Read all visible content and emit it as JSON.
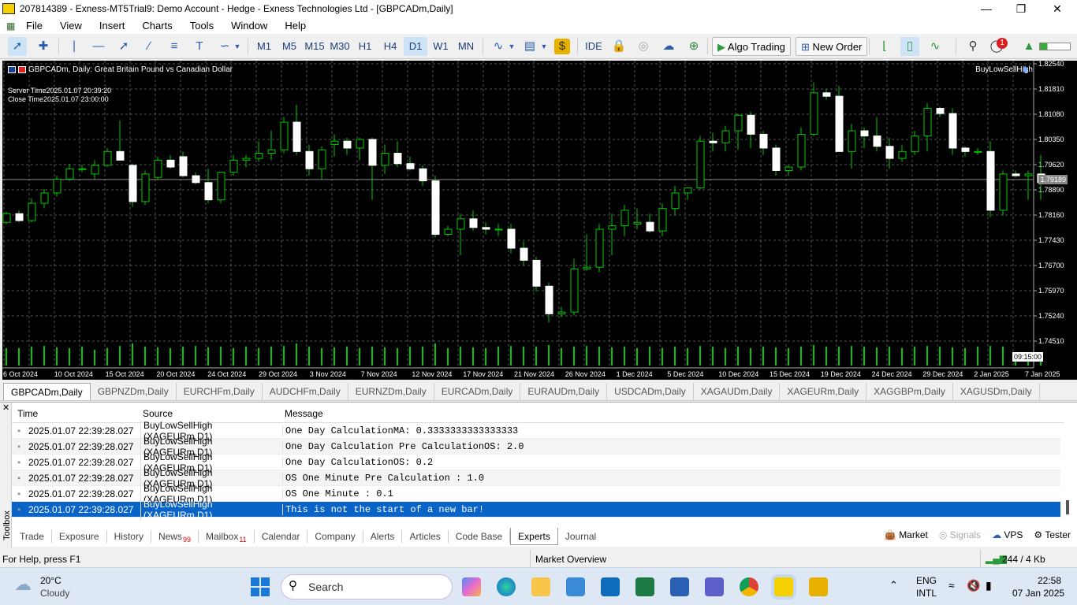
{
  "window": {
    "title": "207814389 - Exness-MT5Trial9: Demo Account - Hedge - Exness Technologies Ltd - [GBPCADm,Daily]"
  },
  "menu": [
    "File",
    "View",
    "Insert",
    "Charts",
    "Tools",
    "Window",
    "Help"
  ],
  "toolbar": {
    "timeframes": [
      "M1",
      "M5",
      "M15",
      "M30",
      "H1",
      "H4",
      "D1",
      "W1",
      "MN"
    ],
    "active_timeframe": "D1",
    "ide_label": "IDE",
    "algo_trading_label": "Algo Trading",
    "new_order_label": "New Order",
    "notification_count": "1"
  },
  "chart": {
    "header": "GBPCADm, Daily:  Great Britain Pound vs Canadian Dollar",
    "server_time": "Server Time2025.01.07 20:39:20",
    "close_time": "Close Time2025.01.07 23:00:00",
    "ea_name": "BuyLowSellHigh",
    "current_price": "1.79189",
    "countdown": "09:15:00",
    "price_labels": [
      "1.82540",
      "1.81810",
      "1.81080",
      "1.80350",
      "1.79620",
      "1.78890",
      "1.78160",
      "1.77430",
      "1.76700",
      "1.75970",
      "1.75240",
      "1.74510"
    ],
    "date_labels": [
      "6 Oct 2024",
      "10 Oct 2024",
      "15 Oct 2024",
      "20 Oct 2024",
      "24 Oct 2024",
      "29 Oct 2024",
      "3 Nov 2024",
      "7 Nov 2024",
      "12 Nov 2024",
      "17 Nov 2024",
      "21 Nov 2024",
      "26 Nov 2024",
      "1 Dec 2024",
      "5 Dec 2024",
      "10 Dec 2024",
      "15 Dec 2024",
      "19 Dec 2024",
      "24 Dec 2024",
      "29 Dec 2024",
      "2 Jan 2025",
      "7 Jan 2025"
    ]
  },
  "chart_tabs": [
    "GBPCADm,Daily",
    "GBPNZDm,Daily",
    "EURCHFm,Daily",
    "AUDCHFm,Daily",
    "EURNZDm,Daily",
    "EURCADm,Daily",
    "EURAUDm,Daily",
    "USDCADm,Daily",
    "XAGAUDm,Daily",
    "XAGEURm,Daily",
    "XAGGBPm,Daily",
    "XAGUSDm,Daily"
  ],
  "log": {
    "headers": {
      "time": "Time",
      "source": "Source",
      "message": "Message"
    },
    "rows": [
      {
        "time": "2025.01.07 22:39:28.027",
        "source": "BuyLowSellHigh (XAGEURm,D1)",
        "message": "One Day CalculationMA: 0.3333333333333333"
      },
      {
        "time": "2025.01.07 22:39:28.027",
        "source": "BuyLowSellHigh (XAGEURm,D1)",
        "message": "One Day Calculation Pre CalculationOS: 2.0"
      },
      {
        "time": "2025.01.07 22:39:28.027",
        "source": "BuyLowSellHigh (XAGEURm,D1)",
        "message": "One Day CalculationOS: 0.2"
      },
      {
        "time": "2025.01.07 22:39:28.027",
        "source": "BuyLowSellHigh (XAGEURm,D1)",
        "message": "OS One Minute Pre Calculation : 1.0"
      },
      {
        "time": "2025.01.07 22:39:28.027",
        "source": "BuyLowSellHigh (XAGEURm,D1)",
        "message": "OS One Minute : 0.1"
      },
      {
        "time": "2025.01.07 22:39:28.027",
        "source": "BuyLowSellHigh (XAGEURm,D1)",
        "message": "This is not the start of a new bar!"
      }
    ]
  },
  "toolbox": {
    "label": "Toolbox",
    "tabs": [
      "Trade",
      "Exposure",
      "History",
      "News",
      "Mailbox",
      "Calendar",
      "Company",
      "Alerts",
      "Articles",
      "Code Base",
      "Experts",
      "Journal"
    ],
    "news_count": "99",
    "mailbox_count": "11",
    "active_tab": "Experts",
    "right": [
      "Market",
      "Signals",
      "VPS",
      "Tester"
    ]
  },
  "status": {
    "help": "For Help, press F1",
    "market": "Market Overview",
    "traffic": "244 / 4 Kb"
  },
  "taskbar": {
    "temp": "20°C",
    "weather": "Cloudy",
    "search": "Search",
    "lang": "ENG",
    "layout": "INTL",
    "time": "22:58",
    "date": "07 Jan 2025"
  },
  "colors": {
    "accent": "#0a64c8",
    "chart_bg": "#000000",
    "bull": "#00c800",
    "bear": "#ffffff",
    "selected_row": "#0a64c8"
  },
  "candles": [
    [
      1.7795,
      1.7825,
      1.779,
      1.782
    ],
    [
      1.782,
      1.783,
      1.7795,
      1.78
    ],
    [
      1.78,
      1.7865,
      1.7795,
      1.785
    ],
    [
      1.785,
      1.7892,
      1.7835,
      1.788
    ],
    [
      1.788,
      1.793,
      1.787,
      1.792
    ],
    [
      1.792,
      1.7965,
      1.7915,
      1.795
    ],
    [
      1.795,
      1.7962,
      1.794,
      1.795
    ],
    [
      1.7935,
      1.7975,
      1.792,
      1.796
    ],
    [
      1.796,
      1.801,
      1.7955,
      1.8
    ],
    [
      1.8,
      1.809,
      1.7975,
      1.7975
    ],
    [
      1.796,
      1.7965,
      1.784,
      1.7855
    ],
    [
      1.7855,
      1.7945,
      1.7845,
      1.7935
    ],
    [
      1.7925,
      1.7985,
      1.792,
      1.7975
    ],
    [
      1.7975,
      1.799,
      1.795,
      1.7955
    ],
    [
      1.7985,
      1.8,
      1.7925,
      1.793
    ],
    [
      1.793,
      1.794,
      1.7905,
      1.791
    ],
    [
      1.791,
      1.795,
      1.785,
      1.786
    ],
    [
      1.786,
      1.794,
      1.785,
      1.794
    ],
    [
      1.794,
      1.799,
      1.793,
      1.7975
    ],
    [
      1.7975,
      1.799,
      1.7955,
      1.798
    ],
    [
      1.798,
      1.803,
      1.797,
      1.7995
    ],
    [
      1.7995,
      1.806,
      1.7975,
      1.8005
    ],
    [
      1.8005,
      1.81,
      1.7995,
      1.8085
    ],
    [
      1.8085,
      1.8135,
      1.799,
      1.8
    ],
    [
      1.8,
      1.802,
      1.793,
      1.795
    ],
    [
      1.795,
      1.8015,
      1.792,
      1.8005
    ],
    [
      1.802,
      1.805,
      1.7985,
      1.803
    ],
    [
      1.803,
      1.804,
      1.799,
      1.801
    ],
    [
      1.801,
      1.804,
      1.7975,
      1.8035
    ],
    [
      1.8035,
      1.804,
      1.786,
      1.796
    ],
    [
      1.796,
      1.802,
      1.7935,
      1.7995
    ],
    [
      1.7995,
      1.803,
      1.7955,
      1.7965
    ],
    [
      1.7965,
      1.7985,
      1.7945,
      1.795
    ],
    [
      1.795,
      1.796,
      1.79,
      1.7915
    ],
    [
      1.7915,
      1.793,
      1.775,
      1.776
    ],
    [
      1.776,
      1.7785,
      1.7755,
      1.7775
    ],
    [
      1.7775,
      1.782,
      1.77,
      1.7805
    ],
    [
      1.7805,
      1.783,
      1.777,
      1.778
    ],
    [
      1.778,
      1.7795,
      1.776,
      1.7775
    ],
    [
      1.7775,
      1.779,
      1.7755,
      1.7775
    ],
    [
      1.7775,
      1.779,
      1.7705,
      1.772
    ],
    [
      1.772,
      1.774,
      1.767,
      1.7685
    ],
    [
      1.7685,
      1.7695,
      1.7595,
      1.761
    ],
    [
      1.761,
      1.762,
      1.7505,
      1.753
    ],
    [
      1.753,
      1.755,
      1.752,
      1.7535
    ],
    [
      1.7535,
      1.769,
      1.7525,
      1.766
    ],
    [
      1.766,
      1.776,
      1.7655,
      1.7665
    ],
    [
      1.7665,
      1.779,
      1.765,
      1.7775
    ],
    [
      1.7775,
      1.782,
      1.77,
      1.7785
    ],
    [
      1.7785,
      1.7845,
      1.7755,
      1.783
    ],
    [
      1.779,
      1.7835,
      1.7775,
      1.7795
    ],
    [
      1.7795,
      1.782,
      1.7765,
      1.777
    ],
    [
      1.777,
      1.785,
      1.7755,
      1.7835
    ],
    [
      1.7835,
      1.79,
      1.7815,
      1.788
    ],
    [
      1.788,
      1.7895,
      1.786,
      1.7895
    ],
    [
      1.7895,
      1.8045,
      1.789,
      1.803
    ],
    [
      1.803,
      1.8055,
      1.8,
      1.8025
    ],
    [
      1.8025,
      1.8075,
      1.8,
      1.806
    ],
    [
      1.806,
      1.811,
      1.8005,
      1.8105
    ],
    [
      1.8105,
      1.8115,
      1.801,
      1.805
    ],
    [
      1.805,
      1.806,
      1.799,
      1.801
    ],
    [
      1.801,
      1.802,
      1.793,
      1.7945
    ],
    [
      1.7945,
      1.796,
      1.793,
      1.7955
    ],
    [
      1.7955,
      1.807,
      1.7945,
      1.805
    ],
    [
      1.805,
      1.82,
      1.8045,
      1.817
    ],
    [
      1.817,
      1.818,
      1.815,
      1.816
    ],
    [
      1.816,
      1.819,
      1.8,
      1.8
    ],
    [
      1.8,
      1.808,
      1.795,
      1.806
    ],
    [
      1.806,
      1.807,
      1.801,
      1.8045
    ],
    [
      1.8045,
      1.81,
      1.8,
      1.8015
    ],
    [
      1.8015,
      1.804,
      1.795,
      1.798
    ],
    [
      1.798,
      1.802,
      1.797,
      1.8
    ],
    [
      1.8,
      1.806,
      1.799,
      1.8045
    ],
    [
      1.8045,
      1.814,
      1.8,
      1.8125
    ],
    [
      1.8125,
      1.813,
      1.81,
      1.811
    ],
    [
      1.811,
      1.8125,
      1.799,
      1.801
    ],
    [
      1.801,
      1.8015,
      1.7985,
      1.8
    ],
    [
      1.8,
      1.801,
      1.799,
      1.8
    ],
    [
      1.8,
      1.803,
      1.781,
      1.783
    ],
    [
      1.783,
      1.7945,
      1.7815,
      1.7935
    ],
    [
      1.7935,
      1.7945,
      1.7925,
      1.793
    ],
    [
      1.793,
      1.7945,
      1.786,
      1.7935
    ],
    [
      1.7935,
      1.799,
      1.786,
      1.791
    ]
  ],
  "volumes": [
    0.55,
    0.55,
    0.6,
    0.62,
    0.58,
    0.55,
    0.6,
    0.5,
    0.56,
    0.62,
    0.7,
    0.6,
    0.58,
    0.55,
    0.6,
    0.62,
    0.58,
    0.6,
    0.55,
    0.6,
    0.56,
    0.6,
    0.62,
    0.7,
    0.6,
    0.55,
    0.58,
    0.6,
    0.56,
    0.6,
    0.58,
    0.55,
    0.6,
    0.6,
    0.7,
    0.55,
    0.6,
    0.58,
    0.55,
    0.6,
    0.62,
    0.6,
    0.6,
    0.65,
    0.55,
    0.6,
    0.62,
    0.6,
    0.58,
    0.6,
    0.55,
    0.6,
    0.56,
    0.6,
    0.55,
    0.62,
    0.6,
    0.56,
    0.6,
    0.55,
    0.6,
    0.58,
    0.55,
    0.6,
    0.65,
    0.6,
    0.6,
    0.62,
    0.6,
    0.58,
    0.6,
    0.56,
    0.6,
    0.62,
    0.6,
    0.58,
    0.55,
    0.6,
    0.62,
    0.6,
    0.3,
    0.25,
    0.2
  ]
}
